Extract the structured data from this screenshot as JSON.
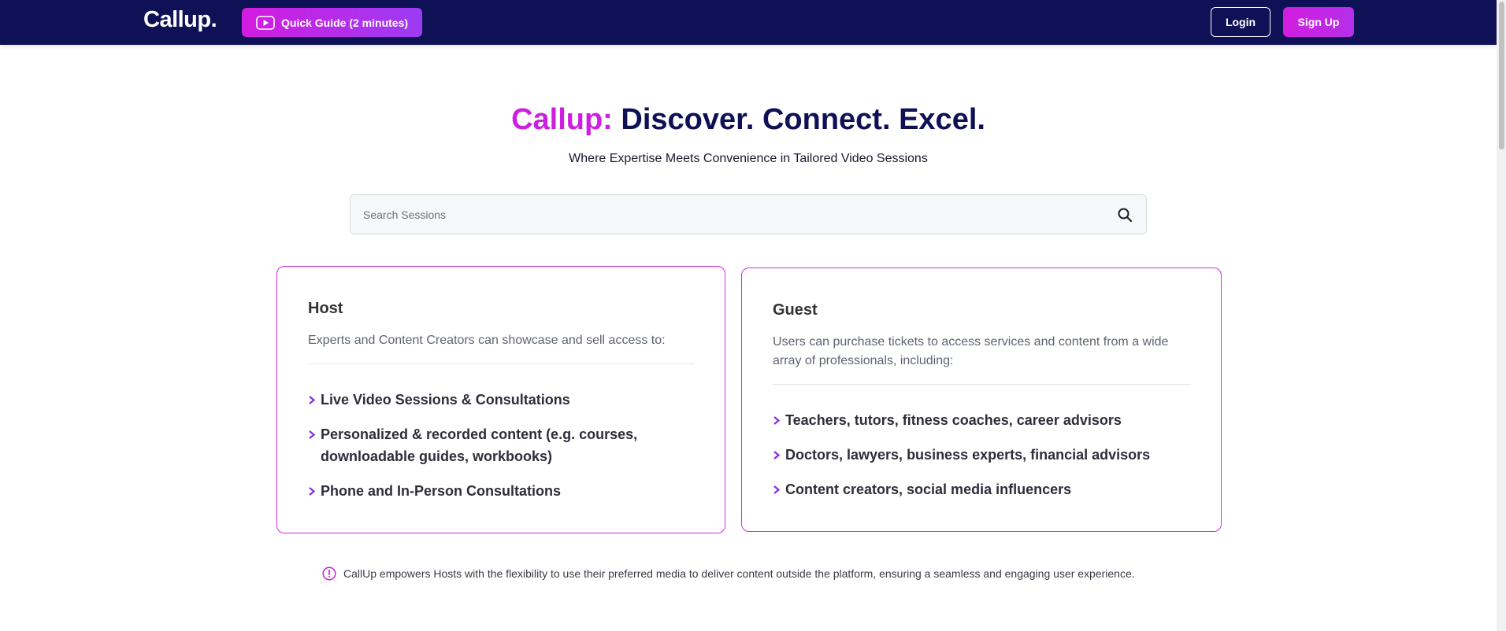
{
  "header": {
    "logo": "Callup.",
    "guide_label": "Quick Guide (2 minutes)",
    "login_label": "Login",
    "signup_label": "Sign Up",
    "colors": {
      "navy": "#0f1156",
      "accent": "#d21ce0"
    }
  },
  "hero": {
    "title_accent": "Callup:",
    "title_rest": "Discover. Connect. Excel.",
    "subtitle": "Where Expertise Meets Convenience in Tailored Video Sessions"
  },
  "search": {
    "placeholder": "Search Sessions",
    "value": "",
    "icon": "search-icon"
  },
  "host": {
    "title": "Host",
    "description": "Experts and Content Creators can showcase and sell access to:",
    "items": [
      "Live Video Sessions & Consultations",
      "Personalized & recorded content (e.g. courses, downloadable guides, workbooks)",
      "Phone and In-Person Consultations"
    ]
  },
  "guest": {
    "title": "Guest",
    "description": "Users can purchase tickets to access services and content from a wide array of professionals, including:",
    "items": [
      "Teachers, tutors, fitness coaches, career advisors",
      "Doctors, lawyers, business experts, financial advisors",
      "Content creators, social media influencers"
    ]
  },
  "note": {
    "icon": "info-icon",
    "text": "CallUp empowers Hosts with the flexibility to use their preferred media to deliver content outside the platform, ensuring a seamless and engaging user experience."
  }
}
